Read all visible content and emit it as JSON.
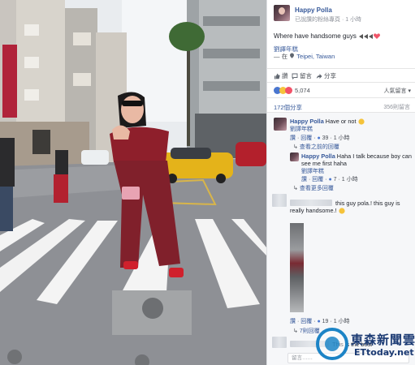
{
  "post": {
    "page_name": "Happy Polla",
    "subtitle": "已說讚的粉絲專頁 · 1 小時",
    "caption": "Where have handsome guys",
    "tag_name": "劉譯年糕",
    "location_prefix": "— 在",
    "location_name": "Teipei, Taiwan"
  },
  "actions": {
    "like": "讚",
    "comment": "留言",
    "share": "分享"
  },
  "reactions": {
    "count": "5,074",
    "sort_label": "人氣留言 ▾"
  },
  "stats": {
    "shares": "172個分享",
    "comments": "356則留言"
  },
  "comments": [
    {
      "author": "Happy Polla",
      "text": "Have or not",
      "tag": "劉譯年糕",
      "meta": {
        "like": "讚",
        "reply": "回覆",
        "likes": "39",
        "time": "1 小時"
      },
      "view_prev": "查看之前的回覆"
    },
    {
      "author": "Happy Polla",
      "text": "Haha I talk because boy can see me first haha",
      "tag": "劉譯年糕",
      "meta": {
        "like": "讚",
        "reply": "回覆",
        "likes": "7",
        "time": "1 小時"
      },
      "view_more": "查看更多回覆"
    },
    {
      "text": "this guy pola.! this guy is really handsome.!",
      "meta": {
        "like": "讚",
        "reply": "回覆",
        "likes": "19",
        "time": "1 小時"
      },
      "replies": "7則回覆"
    },
    {
      "text": "This is the best"
    }
  ],
  "reply_placeholder": "留言……",
  "watermark": {
    "cn": "東森新聞雲",
    "en": "ETtoday.net"
  },
  "colors": {
    "link": "#365899",
    "watermark_blue": "#1c84c6",
    "dress_red": "#8e1f2b",
    "taxi_yellow": "#e4b31a"
  }
}
